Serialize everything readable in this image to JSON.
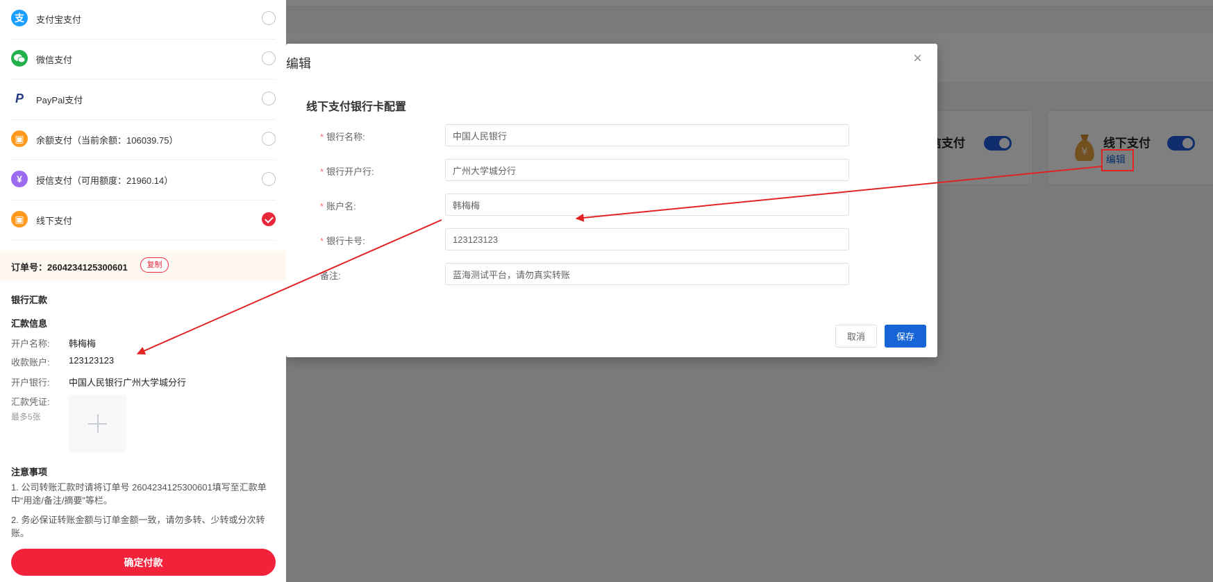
{
  "background": {
    "card_a_title": "信支付",
    "card_b_title": "线下支付",
    "card_b_edit": "编辑",
    "accent_color": "#1664d6"
  },
  "dialog": {
    "title": "编辑",
    "section_title": "线下支付银行卡配置",
    "fields": [
      {
        "label": "银行名称:",
        "value": "中国人民银行",
        "required": true
      },
      {
        "label": "银行开户行:",
        "value": "广州大学城分行",
        "required": true
      },
      {
        "label": "账户名:",
        "value": "韩梅梅",
        "required": true
      },
      {
        "label": "银行卡号:",
        "value": "123123123",
        "required": true
      },
      {
        "label": "备注:",
        "value": "蓝海测试平台，请勿真实转账",
        "required": false
      }
    ],
    "cancel_label": "取消",
    "save_label": "保存"
  },
  "drawer": {
    "payment_methods": [
      {
        "label": "支付宝支付",
        "icon": "alipay-icon",
        "color": "#1a9fff",
        "checked": false
      },
      {
        "label": "微信支付",
        "icon": "wechat-icon",
        "color": "#22b14c",
        "checked": false
      },
      {
        "label": "PayPal支付",
        "icon": "paypal-icon",
        "color": "#253b80",
        "checked": false
      },
      {
        "label": "余额支付（当前余额：106039.75）",
        "icon": "wallet-icon",
        "color": "#ff9a1e",
        "checked": false
      },
      {
        "label": "授信支付（可用额度：21960.14）",
        "icon": "credit-icon",
        "color": "#9b6cf0",
        "checked": false
      },
      {
        "label": "线下支付",
        "icon": "wallet-icon",
        "color": "#ff9a1e",
        "checked": true
      }
    ],
    "order_label": "订单号：2604234125300601",
    "copy_label": "复制",
    "bank_transfer_title": "银行汇款",
    "remit_info_title": "汇款信息",
    "account_name_label": "开户名称:",
    "account_name_value": "韩梅梅",
    "account_no_label": "收款账户:",
    "account_no_value": "123123123",
    "bank_label": "开户银行:",
    "bank_value": "中国人民银行广州大学城分行",
    "voucher_label": "汇款凭证:",
    "voucher_hint": "最多5张",
    "notes_title": "注意事项",
    "note_1": "1. 公司转账汇款时请将订单号 2604234125300601填写至汇款单中“用途/备注/摘要”等栏。",
    "note_2": "2. 务必保证转账金额与订单金额一致，请勿多转、少转或分次转账。",
    "confirm_label": "确定付款",
    "brand_color": "#f2223b"
  }
}
